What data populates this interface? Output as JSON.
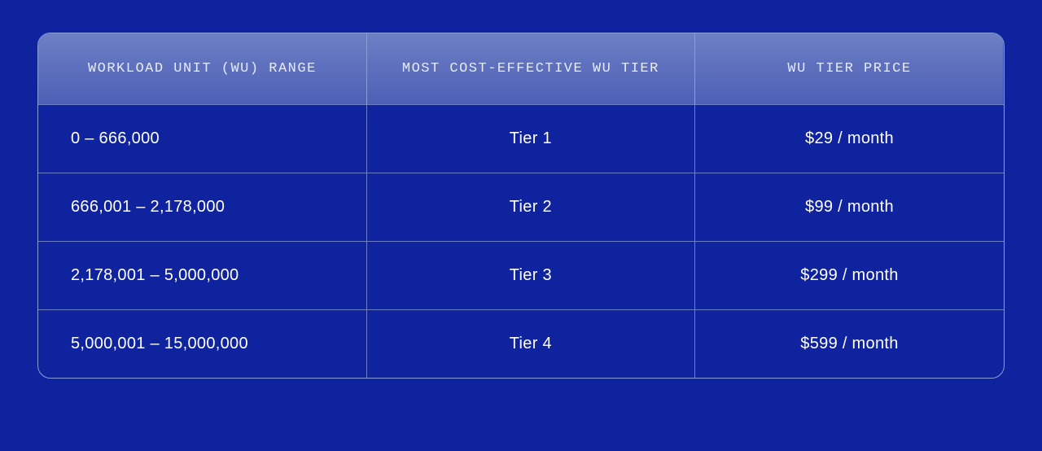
{
  "table": {
    "headers": {
      "col0": "WORKLOAD UNIT (WU) RANGE",
      "col1": "MOST COST-EFFECTIVE WU TIER",
      "col2": "WU TIER PRICE"
    },
    "rows": [
      {
        "range": "0 – 666,000",
        "tier": "Tier 1",
        "price": "$29 / month"
      },
      {
        "range": "666,001 – 2,178,000",
        "tier": "Tier 2",
        "price": "$99 / month"
      },
      {
        "range": "2,178,001 – 5,000,000",
        "tier": "Tier 3",
        "price": "$299 / month"
      },
      {
        "range": "5,000,001 – 15,000,000",
        "tier": "Tier 4",
        "price": "$599 / month"
      }
    ]
  }
}
